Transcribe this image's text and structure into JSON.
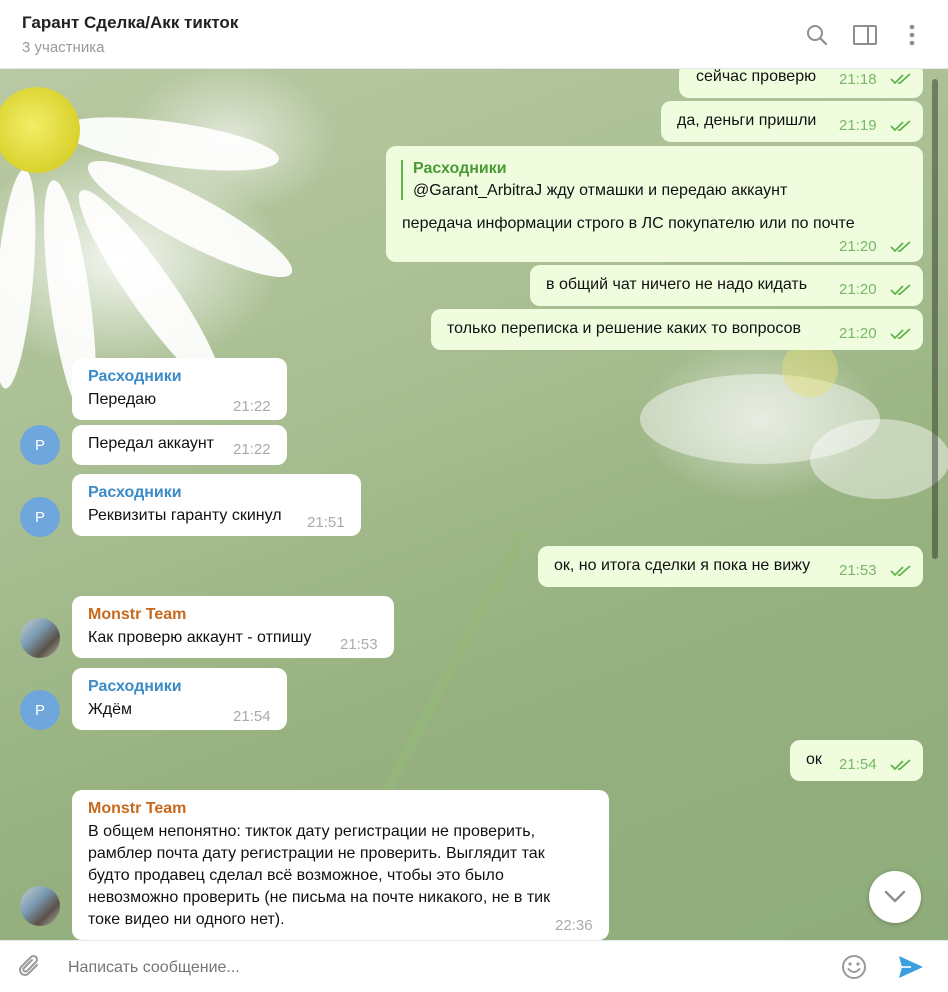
{
  "header": {
    "title": "Гарант Сделка/Акк тикток",
    "subtitle": "3 участника",
    "icons": [
      "search-icon",
      "sidebar-icon",
      "more-icon"
    ]
  },
  "messages": [
    {
      "side": "out",
      "text": "сейчас проверю",
      "time": "21:18"
    },
    {
      "side": "out",
      "text": "да, деньги пришли",
      "time": "21:19"
    },
    {
      "side": "out",
      "reply_to": {
        "name": "Расходники",
        "text": "@Garant_ArbitraJ жду отмашки и передаю аккаунт"
      },
      "text": "передача информации строго в ЛС покупателю или по почте",
      "time": "21:20"
    },
    {
      "side": "out",
      "text": "в общий чат ничего не надо кидать",
      "time": "21:20"
    },
    {
      "side": "out",
      "text": "только переписка и решение каких то вопросов",
      "time": "21:20"
    },
    {
      "side": "in",
      "sender": "Расходники",
      "text": "Передаю",
      "time": "21:22"
    },
    {
      "side": "in",
      "text": "Передал аккаунт",
      "time": "21:22",
      "avatar": "Р"
    },
    {
      "side": "in",
      "sender": "Расходники",
      "text": "Реквизиты гаранту скинул",
      "time": "21:51",
      "avatar": "Р"
    },
    {
      "side": "out",
      "text": "ок, но итога сделки я пока не вижу",
      "time": "21:53"
    },
    {
      "side": "in",
      "sender": "Monstr Team",
      "text": "Как проверю аккаунт - отпишу",
      "time": "21:53"
    },
    {
      "side": "in",
      "sender": "Расходники",
      "text": "Ждём",
      "time": "21:54",
      "avatar": "Р"
    },
    {
      "side": "out",
      "text": "ок",
      "time": "21:54"
    },
    {
      "side": "in",
      "sender": "Monstr Team",
      "lines": [
        "В общем непонятно: тикток дату регистрации не проверить,",
        "рамблер почта дату регистрации не проверить. Выглядит так",
        "будто продавец сделал всё возможное, чтобы это было",
        "невозможно проверить (не письма на почте никакого, не в тик",
        "токе видео ни одного нет)."
      ],
      "time": "22:36"
    }
  ],
  "composer": {
    "placeholder": "Написать сообщение..."
  },
  "colors": {
    "outgoing_bubble": "#effdde",
    "incoming_bubble": "#ffffff",
    "sender_blue": "#3a8bc7",
    "sender_orange": "#c7691d",
    "accent": "#3a9ee0"
  }
}
